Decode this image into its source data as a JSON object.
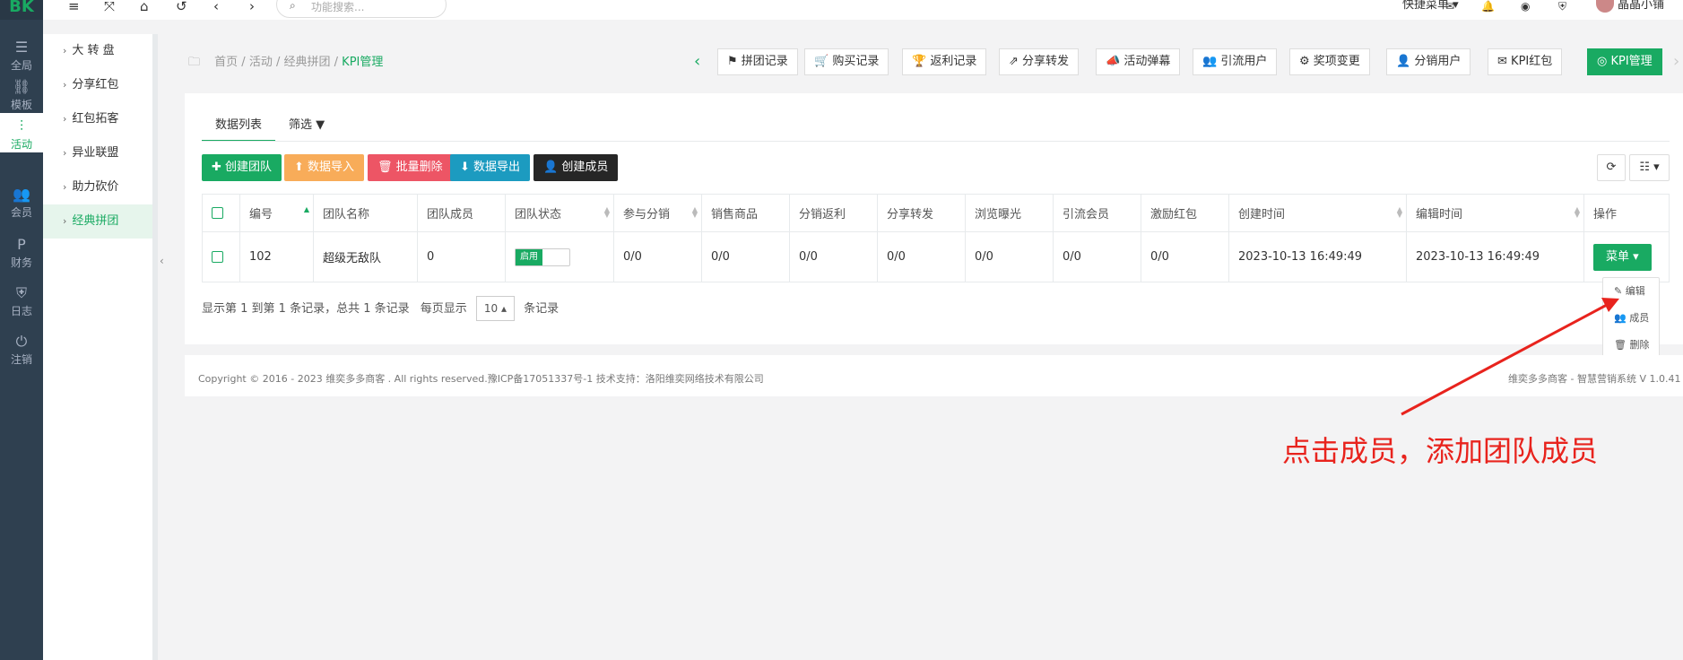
{
  "logo": "BK",
  "left_nav": [
    {
      "icon": "sliders-icon",
      "glyph": "☰",
      "label": "全局"
    },
    {
      "icon": "sitemap-icon",
      "glyph": "⛓",
      "label": "模板"
    },
    {
      "icon": "activity-icon",
      "glyph": "⫶",
      "label": "活动"
    },
    {
      "icon": "users-icon",
      "glyph": "👥",
      "label": "会员"
    },
    {
      "icon": "paypal-icon",
      "glyph": "P",
      "label": "财务"
    },
    {
      "icon": "shield-icon",
      "glyph": "⛨",
      "label": "日志"
    },
    {
      "icon": "power-icon",
      "glyph": "⏻",
      "label": "注销"
    }
  ],
  "topbar": {
    "search_placeholder": "功能搜索...",
    "quick_menu": "快捷菜单 ▾",
    "username": "晶晶小铺"
  },
  "sub_menu": [
    "大 转 盘",
    "分享红包",
    "红包拓客",
    "异业联盟",
    "助力砍价",
    "经典拼团"
  ],
  "breadcrumb": {
    "home": "首页",
    "sep1": " / ",
    "activity": "活动",
    "sep2": " / ",
    "group": "经典拼团",
    "sep3": " / ",
    "current": "KPI管理"
  },
  "tab_buttons": [
    {
      "icon": "⚑",
      "label": "拼团记录"
    },
    {
      "icon": "🛒",
      "label": "购买记录"
    },
    {
      "icon": "🏆",
      "label": "返利记录"
    },
    {
      "icon": "⇗",
      "label": "分享转发"
    },
    {
      "icon": "📣",
      "label": "活动弹幕"
    },
    {
      "icon": "👥",
      "label": "引流用户"
    },
    {
      "icon": "⚙",
      "label": "奖项变更"
    },
    {
      "icon": "👤",
      "label": "分销用户"
    },
    {
      "icon": "✉",
      "label": "KPI红包"
    },
    {
      "icon": "◎",
      "label": "KPI管理"
    }
  ],
  "tabs": {
    "list": "数据列表",
    "filter": "筛选 ▼"
  },
  "actions": {
    "create_team": "✚ 创建团队",
    "import": "⬆ 数据导入",
    "batch_delete": "🗑 批量删除",
    "export": "⬇ 数据导出",
    "create_member": "👤 创建成员",
    "refresh": "⟳",
    "columns": "☷ ▾"
  },
  "table": {
    "headers": [
      "编号",
      "团队名称",
      "团队成员",
      "团队状态",
      "参与分销",
      "销售商品",
      "分销返利",
      "分享转发",
      "浏览曝光",
      "引流会员",
      "激励红包",
      "创建时间",
      "编辑时间",
      "操作"
    ],
    "row": {
      "id": "102",
      "name": "超级无敌队",
      "members": "0",
      "status": "启用",
      "dist": "0/0",
      "sales": "0/0",
      "rebate": "0/0",
      "share": "0/0",
      "views": "0/0",
      "lead": "0/0",
      "redpack": "0/0",
      "created": "2023-10-13 16:49:49",
      "edited": "2023-10-13 16:49:49",
      "menu": "菜单 ▾"
    }
  },
  "dropdown": [
    {
      "icon": "✎",
      "label": "编辑"
    },
    {
      "icon": "👥",
      "label": "成员"
    },
    {
      "icon": "🗑",
      "label": "删除"
    }
  ],
  "pagination": {
    "info": "显示第 1 到第 1 条记录，总共 1 条记录",
    "per_page": "每页显示",
    "size": "10 ▴",
    "suffix": "条记录"
  },
  "footer": {
    "left": "Copyright © 2016 - 2023 维奕多多商客 . All rights reserved.豫ICP备17051337号-1 技术支持：洛阳维奕网络技术有限公司",
    "right": "维奕多多商客 - 智慧营销系统 V 1.0.41"
  },
  "annotation": "点击成员，添加团队成员",
  "colors": {
    "accent": "#19aa62",
    "annotation": "#e8231d",
    "sidebar": "#2f4050"
  }
}
